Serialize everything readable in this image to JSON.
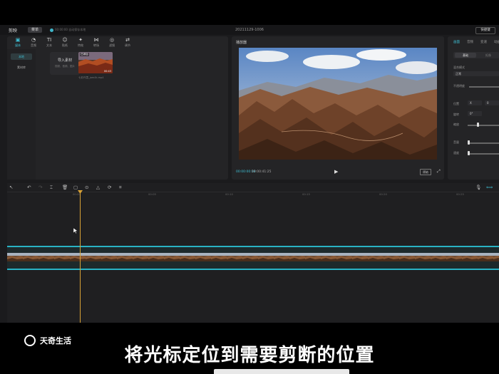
{
  "app": {
    "brand": "剪映",
    "menu_label": "菜单",
    "save_status": "00:00:00 自动保存本地",
    "project_title": "20211129-1006",
    "shortcut_label": "快捷键"
  },
  "media_panel": {
    "tools": [
      {
        "icon": "▣",
        "label": "媒体"
      },
      {
        "icon": "◔",
        "label": "音频"
      },
      {
        "icon": "TI",
        "label": "文本"
      },
      {
        "icon": "☺",
        "label": "贴纸"
      },
      {
        "icon": "✦",
        "label": "特效"
      },
      {
        "icon": "⋈",
        "label": "转场"
      },
      {
        "icon": "◎",
        "label": "滤镜"
      },
      {
        "icon": "⇄",
        "label": "调节"
      }
    ],
    "side_items": [
      "本地",
      "素材库"
    ],
    "import_label": "导入素材",
    "import_hint": "视频、音频、图片",
    "clip_badge": "已添加",
    "clip_duration": "00:43",
    "clip_name": "七彩丹霞_jam4k.mp4"
  },
  "player": {
    "title": "播放器",
    "current_time": "00:00:00:18",
    "total_time": "00:00:41:25",
    "ratio_label": "原始"
  },
  "properties": {
    "tabs": [
      "画面",
      "音频",
      "变速",
      "动画"
    ],
    "seg_on": "基础",
    "seg_off": "抠像",
    "blend_label": "混合模式",
    "blend_value": "正常",
    "opacity_label": "不透明度",
    "position_label": "位置",
    "pos_x": "X",
    "pos_y": "0",
    "rotate_label": "旋转",
    "rotate_value": "0°",
    "scale_label": "缩放",
    "volume_label": "音量",
    "speed_label": "速度"
  },
  "timeline": {
    "ruler": [
      "00:00",
      "00:05",
      "00:10",
      "00:15",
      "00:20",
      "00:25"
    ]
  },
  "overlay": {
    "watermark": "天奇生活",
    "caption": "将光标定位到需要剪断的位置"
  },
  "colors": {
    "accent": "#3fc1d6",
    "playhead": "#d9a236",
    "track": "#29b2c4"
  }
}
